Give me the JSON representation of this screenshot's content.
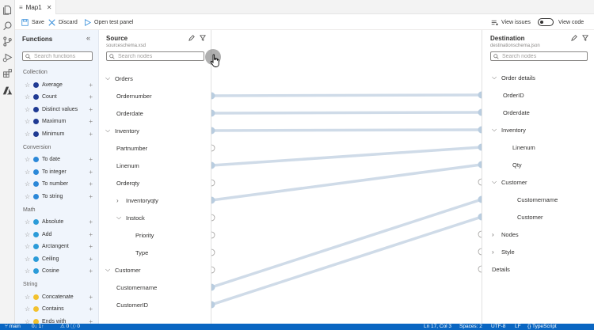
{
  "tab": {
    "label": "Map1"
  },
  "toolbar": {
    "save": "Save",
    "discard": "Discard",
    "open_test_panel": "Open test panel",
    "view_issues": "View issues",
    "view_code": "View code"
  },
  "functions": {
    "title": "Functions",
    "search_placeholder": "Search functions",
    "sections": [
      {
        "name": "Collection",
        "items": [
          {
            "label": "Average",
            "color": "#1f3a93"
          },
          {
            "label": "Count",
            "color": "#1f3a93"
          },
          {
            "label": "Distinct values",
            "color": "#1f3a93"
          },
          {
            "label": "Maximum",
            "color": "#1f3a93"
          },
          {
            "label": "Minimum",
            "color": "#1f3a93"
          }
        ]
      },
      {
        "name": "Conversion",
        "items": [
          {
            "label": "To date",
            "color": "#2b88d8"
          },
          {
            "label": "To integer",
            "color": "#2b88d8"
          },
          {
            "label": "To number",
            "color": "#2b88d8"
          },
          {
            "label": "To string",
            "color": "#2b88d8"
          }
        ]
      },
      {
        "name": "Math",
        "items": [
          {
            "label": "Absolute",
            "color": "#2b9bd8"
          },
          {
            "label": "Add",
            "color": "#2b9bd8"
          },
          {
            "label": "Arctangent",
            "color": "#2b9bd8"
          },
          {
            "label": "Ceiling",
            "color": "#2b9bd8"
          },
          {
            "label": "Cosine",
            "color": "#2b9bd8"
          }
        ]
      },
      {
        "name": "String",
        "items": [
          {
            "label": "Concatenate",
            "color": "#f2c12e"
          },
          {
            "label": "Contains",
            "color": "#f2c12e"
          },
          {
            "label": "Ends with",
            "color": "#f2c12e"
          }
        ]
      }
    ]
  },
  "source": {
    "title": "Source",
    "schema": "sourceschema.xsd",
    "search_placeholder": "Search nodes",
    "nodes": [
      {
        "label": "Orders",
        "chevron": "expanded",
        "handle": false
      },
      {
        "label": "Ordernumber",
        "chevron": "none",
        "handle": "filled"
      },
      {
        "label": "Orderdate",
        "chevron": "none",
        "handle": "filled"
      },
      {
        "label": "Inventory",
        "chevron": "expanded",
        "handle": "filled"
      },
      {
        "label": "Partnumber",
        "chevron": "none",
        "handle": "empty"
      },
      {
        "label": "Linenum",
        "chevron": "none",
        "handle": "filled"
      },
      {
        "label": "Orderqty",
        "chevron": "none",
        "handle": "empty"
      },
      {
        "label": "Inventoryqty",
        "chevron": "collapsed",
        "handle": "filled"
      },
      {
        "label": "Instock",
        "chevron": "expanded",
        "handle": "empty"
      },
      {
        "label": "Priority",
        "chevron": "none",
        "handle": "empty"
      },
      {
        "label": "Type",
        "chevron": "none",
        "handle": "empty"
      },
      {
        "label": "Customer",
        "chevron": "expanded",
        "handle": "empty"
      },
      {
        "label": "Customername",
        "chevron": "none",
        "handle": "filled"
      },
      {
        "label": "CustomerID",
        "chevron": "none",
        "handle": "filled"
      }
    ]
  },
  "destination": {
    "title": "Destination",
    "schema": "destinationschema.json",
    "search_placeholder": "Search nodes",
    "nodes": [
      {
        "label": "Order details",
        "chevron": "expanded",
        "handle": false
      },
      {
        "label": "OrderID",
        "chevron": "none",
        "handle": "filled"
      },
      {
        "label": "Orderdate",
        "chevron": "none",
        "handle": "filled"
      },
      {
        "label": "Inventory",
        "chevron": "expanded",
        "handle": "filled"
      },
      {
        "label": "Linenum",
        "chevron": "none",
        "handle": "filled"
      },
      {
        "label": "Qty",
        "chevron": "none",
        "handle": "filled"
      },
      {
        "label": "Customer",
        "chevron": "expanded",
        "handle": "empty"
      },
      {
        "label": "Customername",
        "chevron": "none",
        "handle": "filled"
      },
      {
        "label": "Customer",
        "chevron": "none",
        "handle": "filled"
      },
      {
        "label": "Nodes",
        "chevron": "collapsed",
        "handle": "empty"
      },
      {
        "label": "Style",
        "chevron": "collapsed",
        "handle": "empty"
      },
      {
        "label": "Details",
        "chevron": "none",
        "handle": "empty"
      }
    ]
  },
  "mappings": [
    {
      "from": "Ordernumber",
      "to": "OrderID"
    },
    {
      "from": "Orderdate",
      "to": "Orderdate"
    },
    {
      "from": "Inventory",
      "to": "Inventory"
    },
    {
      "from": "Linenum",
      "to": "Linenum"
    },
    {
      "from": "Inventoryqty",
      "to": "Qty"
    },
    {
      "from": "Customername",
      "to": "Customername"
    },
    {
      "from": "CustomerID",
      "to": "Customer"
    }
  ],
  "statusbar": {
    "branch": "main",
    "sync": "0↓ 1↑",
    "problems": "⚠ 0  ⓘ 0",
    "position": "Ln 17, Col 3",
    "spaces": "Spaces: 2",
    "encoding": "UTF-8",
    "eol": "LF",
    "language": "{} TypeScript"
  },
  "colors": {
    "accent": "#2b88d8",
    "status_bar": "#0a66c2",
    "link_line": "#cfdbe8",
    "handle_filled": "#b9cde0"
  }
}
